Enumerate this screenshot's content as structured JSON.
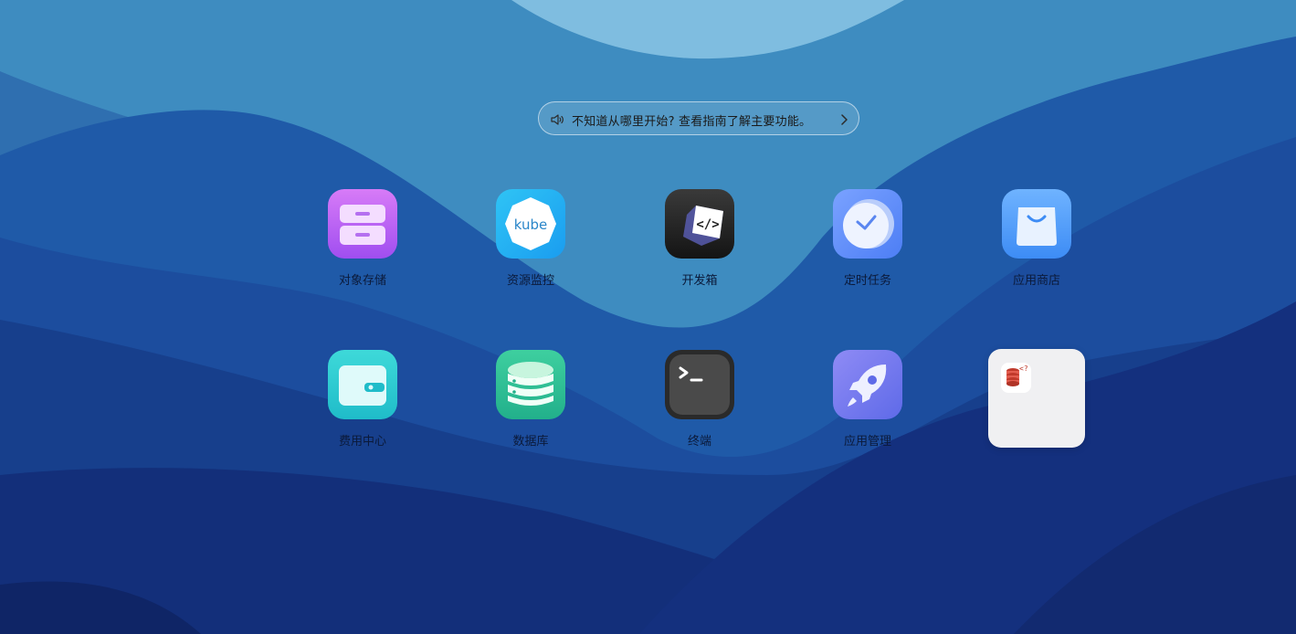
{
  "guide": {
    "text": "不知道从哪里开始? 查看指南了解主要功能。",
    "speaker_icon": "speaker-icon",
    "chevron_icon": "chevron-right-icon"
  },
  "apps": [
    {
      "label": "对象存储",
      "icon": "object-storage-icon"
    },
    {
      "label": "资源监控",
      "icon": "kube-monitor-icon",
      "icon_text": "kube"
    },
    {
      "label": "开发箱",
      "icon": "devbox-icon"
    },
    {
      "label": "定时任务",
      "icon": "clock-icon"
    },
    {
      "label": "应用商店",
      "icon": "shopping-bag-icon"
    },
    {
      "label": "费用中心",
      "icon": "wallet-icon"
    },
    {
      "label": "数据库",
      "icon": "database-icon"
    },
    {
      "label": "终端",
      "icon": "terminal-icon"
    },
    {
      "label": "应用管理",
      "icon": "rocket-icon"
    }
  ],
  "popup": {
    "icon": "database-code-icon"
  },
  "colors": {
    "background_deep": "#1a3f94",
    "background_light": "#7fbde0",
    "label": "#0b1a3a"
  }
}
